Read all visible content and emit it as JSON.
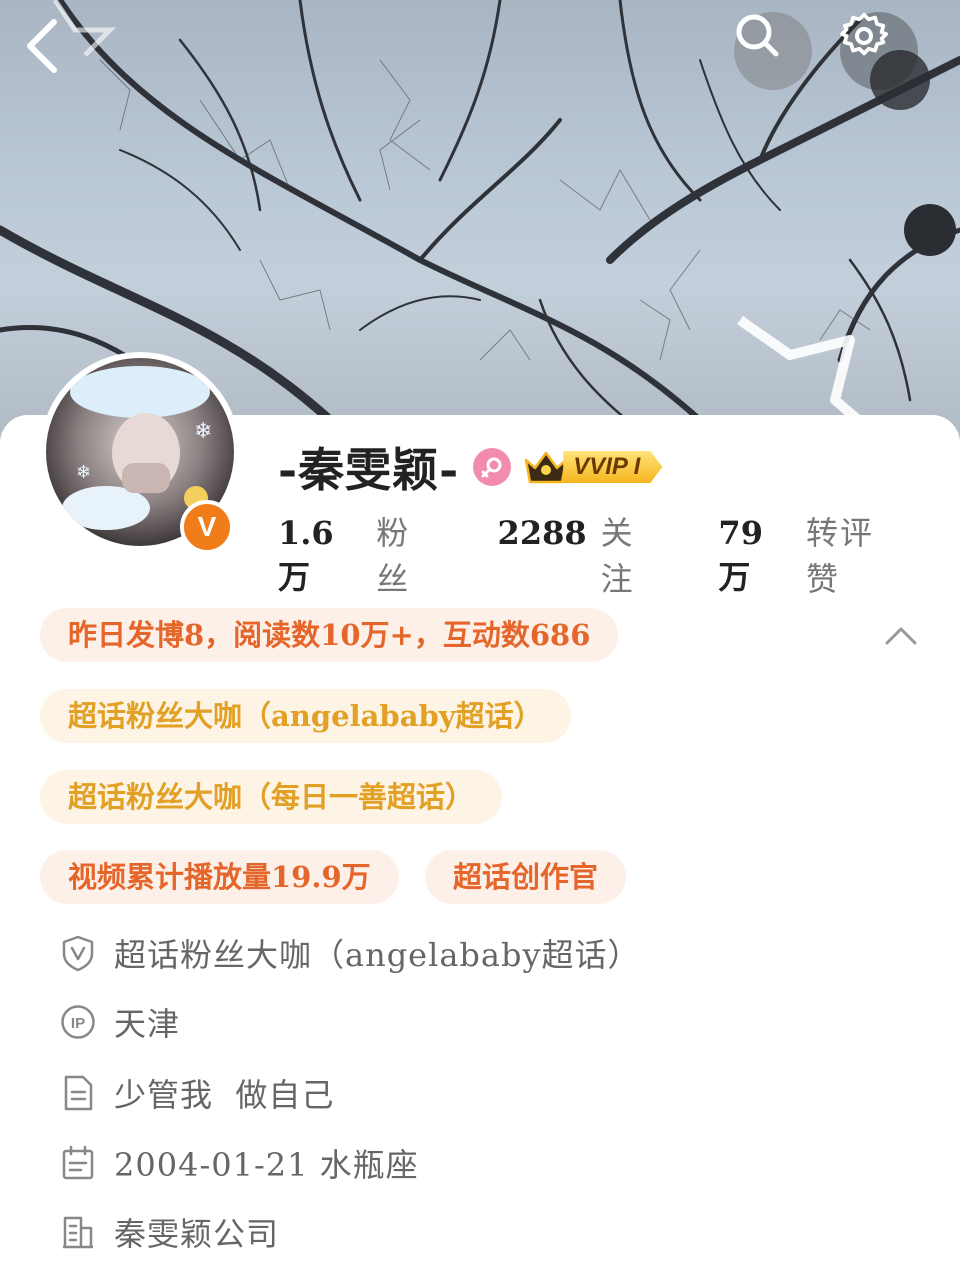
{
  "header": {
    "back_icon": "chevron-left-icon",
    "search_icon": "search-icon",
    "settings_icon": "gear-icon"
  },
  "profile": {
    "username": "-秦雯颖-",
    "gender_icon": "female-icon",
    "vip_label": "VVIP I",
    "verified_label": "V"
  },
  "stats": [
    {
      "value": "1.6万",
      "label": "粉丝"
    },
    {
      "value": "2288",
      "label": "关注"
    },
    {
      "value": "79万",
      "label": "转评赞"
    }
  ],
  "tags": {
    "activity": "昨日发博8，阅读数10万+，互动数686",
    "superfan_1": "超话粉丝大咖（angelababy超话）",
    "superfan_2": "超话粉丝大咖（每日一善超话）",
    "video_plays": "视频累计播放量19.9万",
    "creator": "超话创作官"
  },
  "info": {
    "verification": "超话粉丝大咖（angelababy超话）",
    "ip": "天津",
    "ip_icon_label": "IP",
    "bio": "少管我  做自己",
    "birthday": "2004-01-21 水瓶座",
    "company": "秦雯颖公司"
  },
  "colors": {
    "accent_orange": "#e5662a",
    "accent_gold": "#e2a125",
    "verified": "#f07d1a",
    "gender": "#f28bb0"
  }
}
